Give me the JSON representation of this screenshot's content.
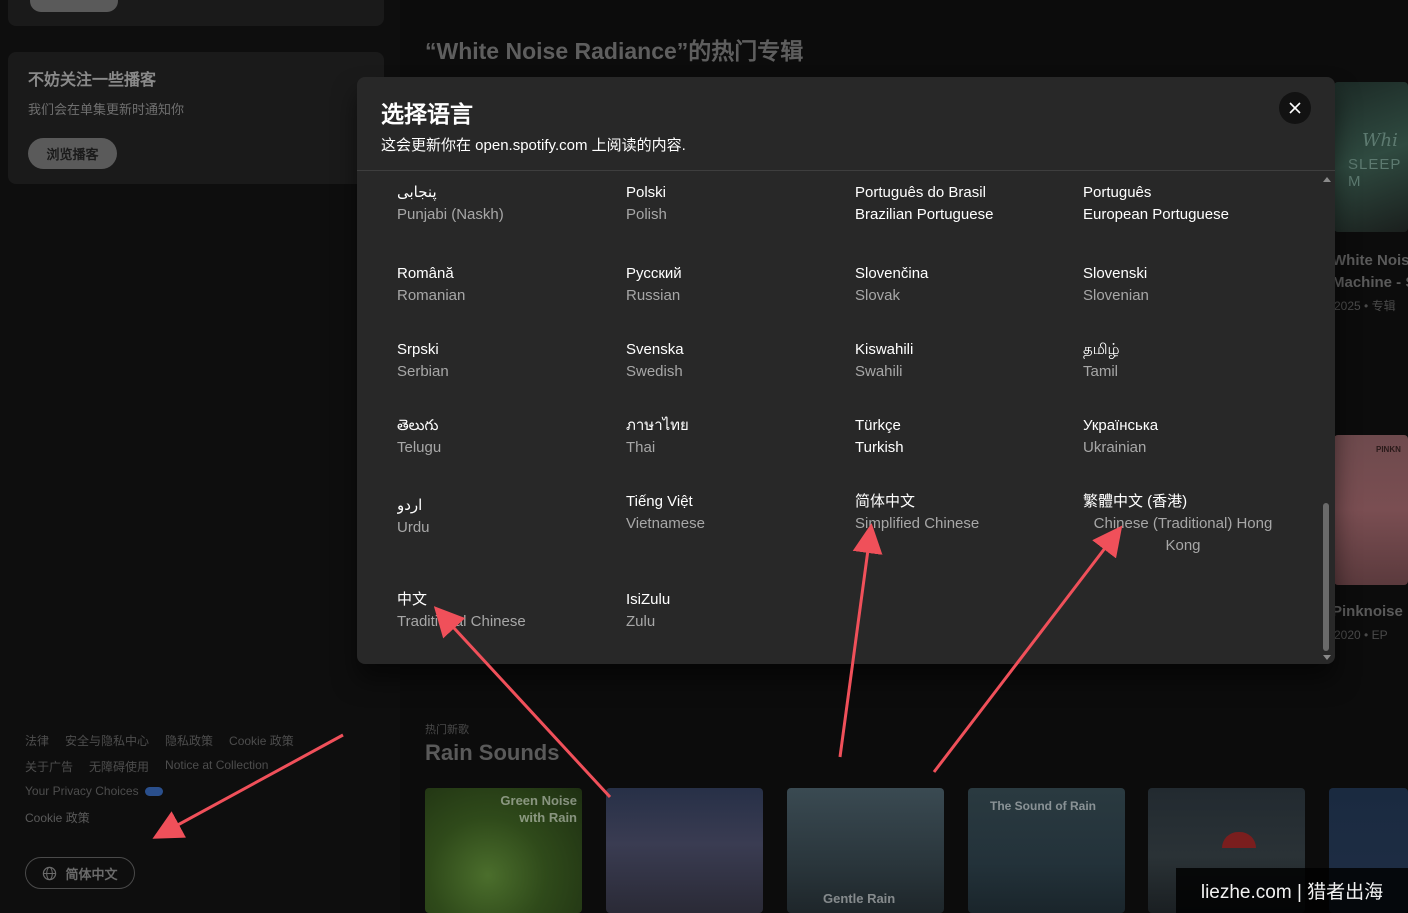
{
  "sidebar": {
    "card_title": "不妨关注一些播客",
    "card_subtitle": "我们会在单集更新时通知你",
    "card_button": "浏览播客",
    "footer_row1": [
      "法律",
      "安全与隐私中心",
      "隐私政策",
      "Cookie 政策"
    ],
    "footer_row2": [
      "关于广告",
      "无障碍使用",
      "Notice at Collection"
    ],
    "privacy_choices": "Your Privacy Choices",
    "cookie_link": "Cookie 政策",
    "language_button": "简体中文"
  },
  "main": {
    "title": "“White Noise Radiance”的热门专辑",
    "right_card1": {
      "art_text1": "Whi",
      "art_text2": "SLEEP M",
      "name_line1": "White Nois",
      "name_line2": "Machine - S",
      "meta": "2025 • 专辑"
    },
    "right_card2": {
      "art_text": "PINKN",
      "name": "Pinknoise",
      "meta": "2020 • EP"
    },
    "section_kicker": "热门新歌",
    "section_title": "Rain Sounds",
    "tiles": [
      {
        "label": "Green Noise with Rain"
      },
      {
        "label": ""
      },
      {
        "label": "Gentle Rain"
      },
      {
        "label": "The Sound of Rain"
      },
      {
        "label": ""
      },
      {
        "label": ""
      }
    ]
  },
  "watermark": "liezhe.com | 猎者出海",
  "modal": {
    "title": "选择语言",
    "subtitle": "这会更新你在 open.spotify.com 上阅读的内容.",
    "close_icon": "close-icon",
    "languages": [
      [
        {
          "native": "پنجابی",
          "english": "Punjabi (Naskh)"
        },
        {
          "native": "Polski",
          "english": "Polish"
        },
        {
          "native": "Português do Brasil",
          "english": "Brazilian Portuguese"
        },
        {
          "native": "Português",
          "english": "European Portuguese"
        }
      ],
      [
        {
          "native": "Română",
          "english": "Romanian"
        },
        {
          "native": "Русский",
          "english": "Russian"
        },
        {
          "native": "Slovenčina",
          "english": "Slovak"
        },
        {
          "native": "Slovenski",
          "english": "Slovenian"
        }
      ],
      [
        {
          "native": "Srpski",
          "english": "Serbian"
        },
        {
          "native": "Svenska",
          "english": "Swedish"
        },
        {
          "native": "Kiswahili",
          "english": "Swahili"
        },
        {
          "native": "தமிழ்",
          "english": "Tamil"
        }
      ],
      [
        {
          "native": "తెలుగు",
          "english": "Telugu"
        },
        {
          "native": "ภาษาไทย",
          "english": "Thai"
        },
        {
          "native": "Türkçe",
          "english": "Turkish"
        },
        {
          "native": "Українська",
          "english": "Ukrainian"
        }
      ],
      [
        {
          "native": "اردو",
          "english": "Urdu"
        },
        {
          "native": "Tiếng Việt",
          "english": "Vietnamese"
        },
        {
          "native": "简体中文",
          "english": "Simplified Chinese"
        },
        {
          "native": "繁體中文 (香港)",
          "english": "Chinese (Traditional) Hong Kong"
        }
      ],
      [
        {
          "native": "中文",
          "english": "Traditional Chinese"
        },
        {
          "native": "IsiZulu",
          "english": "Zulu"
        }
      ]
    ],
    "selected_language": "Türkçe"
  },
  "colors": {
    "modal_bg": "#282828",
    "page_bg": "#000000",
    "annotation_arrow": "#f0505a",
    "secondary_text": "#a7a7a7"
  }
}
